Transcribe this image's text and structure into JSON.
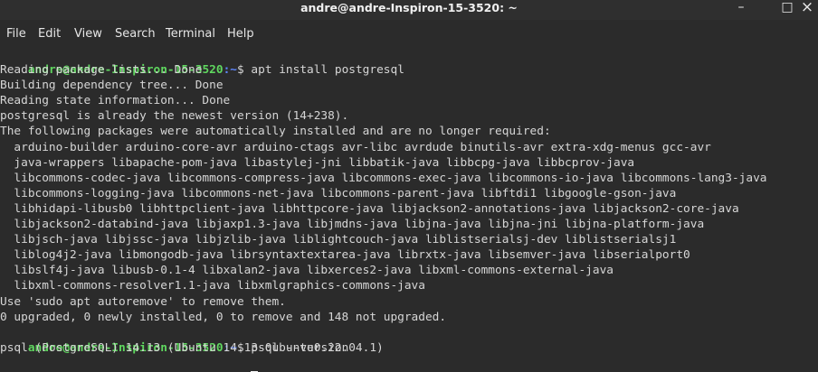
{
  "window": {
    "title": "andre@andre-Inspiron-15-3520: ~",
    "minimize": "–",
    "maximize": "□",
    "close": "×"
  },
  "menu": [
    "File",
    "Edit",
    "View",
    "Search",
    "Terminal",
    "Help"
  ],
  "prompt": {
    "user": "andre@andre-Inspiron-15-3520",
    "path": ":~",
    "sign": "$ "
  },
  "terminal": {
    "cmd1": "apt install postgresql",
    "output1": [
      "Reading package lists... Done",
      "Building dependency tree... Done",
      "Reading state information... Done",
      "postgresql is already the newest version (14+238).",
      "The following packages were automatically installed and are no longer required:",
      "  arduino-builder arduino-core-avr arduino-ctags avr-libc avrdude binutils-avr extra-xdg-menus gcc-avr",
      "  java-wrappers libapache-pom-java libastylej-jni libbatik-java libbcpg-java libbcprov-java",
      "  libcommons-codec-java libcommons-compress-java libcommons-exec-java libcommons-io-java libcommons-lang3-java",
      "  libcommons-logging-java libcommons-net-java libcommons-parent-java libftdi1 libgoogle-gson-java",
      "  libhidapi-libusb0 libhttpclient-java libhttpcore-java libjackson2-annotations-java libjackson2-core-java",
      "  libjackson2-databind-java libjaxp1.3-java libjmdns-java libjna-java libjna-jni libjna-platform-java",
      "  libjsch-java libjssc-java libjzlib-java liblightcouch-java liblistserialsj-dev liblistserialsj1",
      "  liblog4j2-java libmongodb-java librsyntaxtextarea-java librxtx-java libsemver-java libserialport0",
      "  libslf4j-java libusb-0.1-4 libxalan2-java libxerces2-java libxml-commons-external-java",
      "  libxml-commons-resolver1.1-java libxmlgraphics-commons-java",
      "Use 'sudo apt autoremove' to remove them.",
      "0 upgraded, 0 newly installed, 0 to remove and 148 not upgraded."
    ],
    "cmd2": "psql --version",
    "output2": "psql (PostgreSQL) 14.13 (Ubuntu 14.13-0ubuntu0.22.04.1)"
  },
  "colors": {
    "background": "#2b2b2b",
    "prompt_user": "#5fd75f",
    "prompt_path": "#5f87ff",
    "text": "#d6d6d6"
  }
}
